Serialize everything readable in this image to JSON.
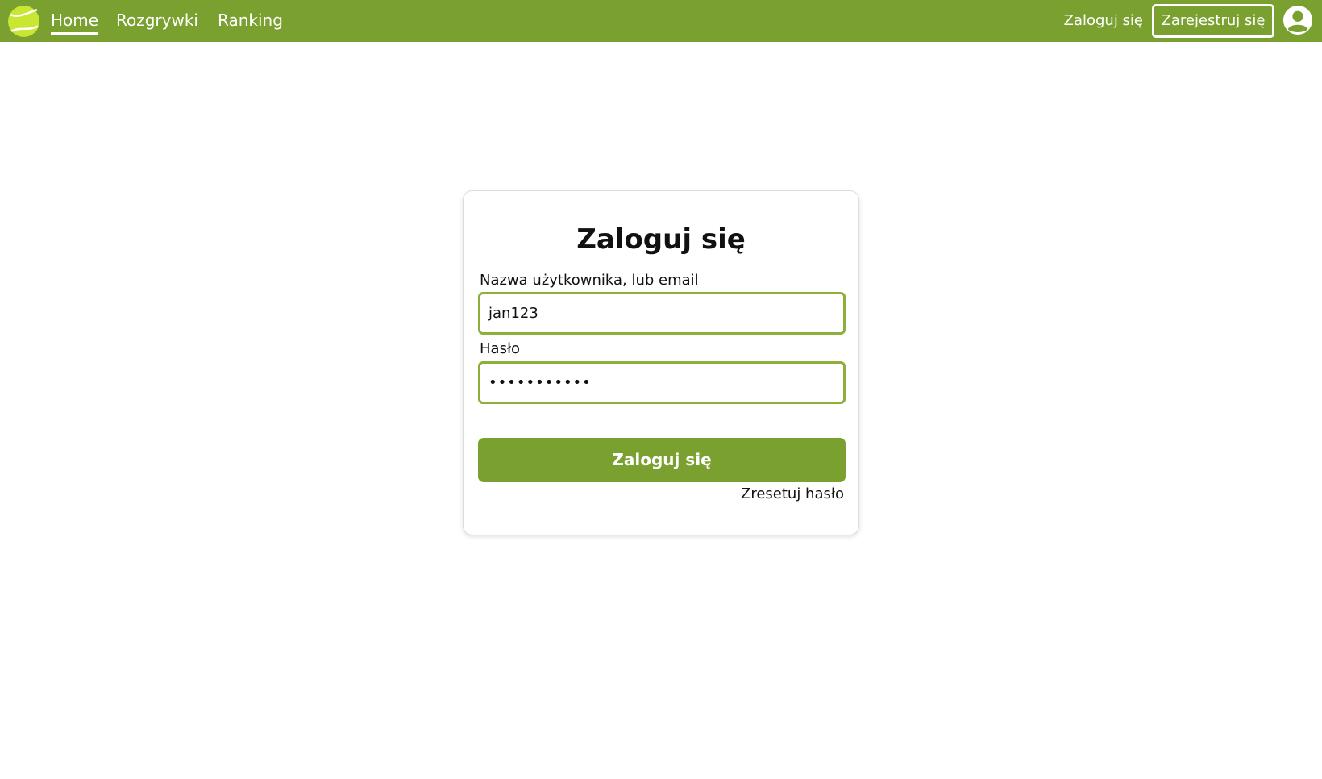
{
  "colors": {
    "brand": "#7aa02f",
    "input_border": "#8db03c",
    "background": "#ffffff",
    "text": "#111111"
  },
  "navbar": {
    "logo_icon": "tennis-ball-icon",
    "links": [
      {
        "label": "Home",
        "active": true
      },
      {
        "label": "Rozgrywki",
        "active": false
      },
      {
        "label": "Ranking",
        "active": false
      }
    ],
    "login_label": "Zaloguj się",
    "register_label": "Zarejestruj się",
    "avatar_icon": "user-circle-icon"
  },
  "login_form": {
    "title": "Zaloguj się",
    "username_label": "Nazwa użytkownika, lub email",
    "username_value": "jan123",
    "password_label": "Hasło",
    "password_value": "•••••••••••",
    "submit_label": "Zaloguj się",
    "reset_label": "Zresetuj hasło"
  }
}
